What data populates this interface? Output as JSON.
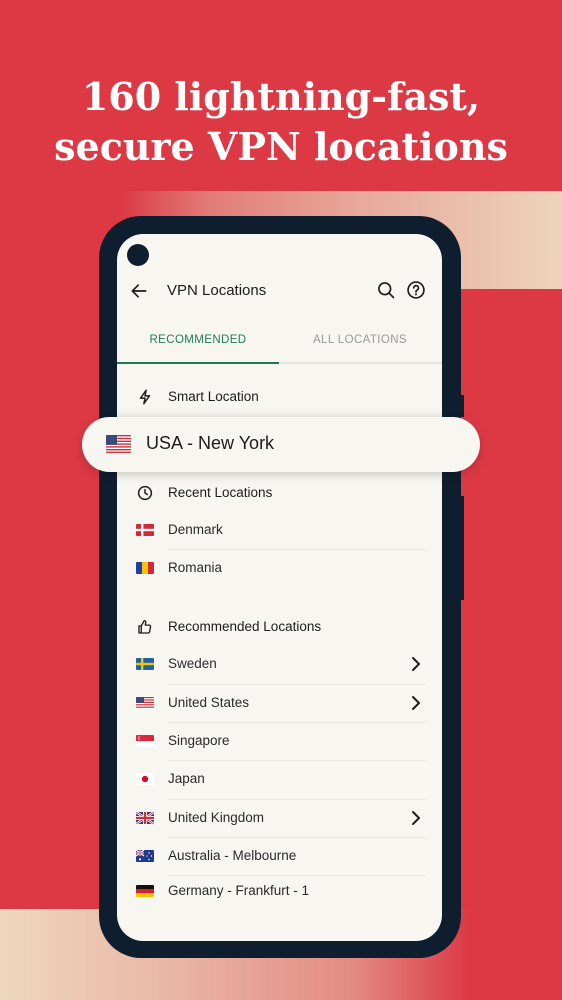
{
  "headline": {
    "line1": "160 lightning-fast,",
    "line2": "secure VPN locations"
  },
  "colors": {
    "background": "#dc3945",
    "phone_frame": "#0f1e2f",
    "screen": "#f7f6f1",
    "accent": "#1d7c57",
    "inactive_tab": "#9a9a9a"
  },
  "appbar": {
    "title": "VPN Locations",
    "back_icon": "arrow-left-icon",
    "search_icon": "search-icon",
    "help_icon": "help-circle-icon"
  },
  "tabs": [
    {
      "label": "RECOMMENDED",
      "active": true
    },
    {
      "label": "ALL LOCATIONS",
      "active": false
    }
  ],
  "smart_location": {
    "icon": "lightning-icon",
    "label": "Smart Location"
  },
  "selected_location": {
    "flag": "us-flag-icon",
    "label": "USA - New York"
  },
  "recent": {
    "icon": "clock-icon",
    "title": "Recent Locations",
    "items": [
      {
        "flag": "dk-flag-icon",
        "label": "Denmark"
      },
      {
        "flag": "ro-flag-icon",
        "label": "Romania"
      }
    ]
  },
  "recommended": {
    "icon": "thumbs-up-icon",
    "title": "Recommended Locations",
    "items": [
      {
        "flag": "se-flag-icon",
        "label": "Sweden",
        "has_children": true
      },
      {
        "flag": "us-flag-icon",
        "label": "United States",
        "has_children": true
      },
      {
        "flag": "sg-flag-icon",
        "label": "Singapore",
        "has_children": false
      },
      {
        "flag": "jp-flag-icon",
        "label": "Japan",
        "has_children": false
      },
      {
        "flag": "gb-flag-icon",
        "label": "United Kingdom",
        "has_children": true
      },
      {
        "flag": "au-flag-icon",
        "label": "Australia - Melbourne",
        "has_children": false
      },
      {
        "flag": "de-flag-icon",
        "label": "Germany - Frankfurt - 1",
        "has_children": false
      }
    ]
  }
}
